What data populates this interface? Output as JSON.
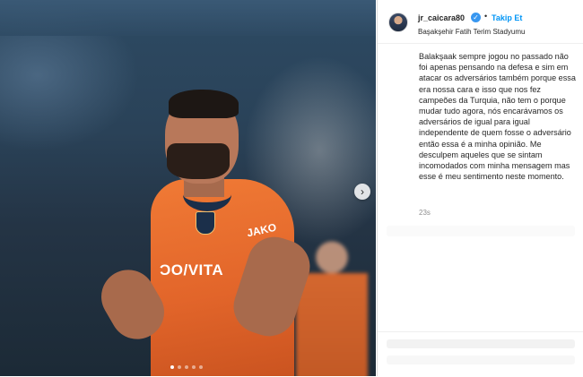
{
  "post": {
    "carousel_position": 1,
    "carousel_total": 5
  },
  "header": {
    "username": "jr_caicara80",
    "verified_glyph": "✓",
    "separator": "•",
    "follow_label": "Takip Et",
    "location": "Başakşehir Fatih Terim Stadyumu"
  },
  "photo": {
    "jersey_sponsor": "ƆO/VITA",
    "sleeve_sponsor": "JAKO",
    "next_glyph": "›"
  },
  "caption": {
    "text": "Balakşaak sempre jogou no passado não foi apenas pensando na defesa e sim em atacar os adversários também porque essa era nossa cara e isso que nos fez campeões da Turquia, não tem o porque mudar tudo agora, nós encarávamos os adversários de igual para igual independente de quem fosse o adversário então essa é a minha opinião. Me desculpem aqueles que se sintam incomodados com minha mensagem mas esse é meu sentimento neste momento.",
    "time": "23s"
  },
  "colors": {
    "accent": "#0095f6",
    "verified": "#3897f0",
    "jersey": "#e86d2e"
  },
  "icons": [
    "verified-badge-icon",
    "chevron-right-icon"
  ]
}
